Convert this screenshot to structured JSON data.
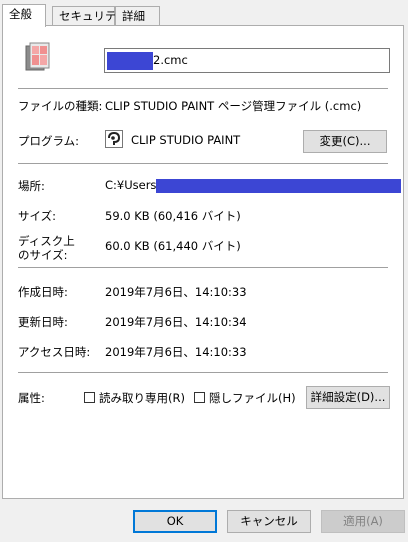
{
  "tabs": [
    "全般",
    "セキュリティ",
    "詳細"
  ],
  "file": {
    "name_suffix": "2.cmc"
  },
  "type": {
    "label": "ファイルの種類:",
    "value": "CLIP STUDIO PAINT ページ管理ファイル (.cmc)"
  },
  "program": {
    "label": "プログラム:",
    "value": "CLIP STUDIO PAINT",
    "change_button": "変更(C)..."
  },
  "location": {
    "label": "場所:",
    "value_prefix": "C:¥Users"
  },
  "size": {
    "label": "サイズ:",
    "value": "59.0 KB (60,416 バイト)"
  },
  "disk_size": {
    "label_line1": "ディスク上",
    "label_line2": "のサイズ:",
    "value": "60.0 KB (61,440 バイト)"
  },
  "created": {
    "label": "作成日時:",
    "value": "2019年7月6日、14:10:33"
  },
  "modified": {
    "label": "更新日時:",
    "value": "2019年7月6日、14:10:34"
  },
  "accessed": {
    "label": "アクセス日時:",
    "value": "2019年7月6日、14:10:33"
  },
  "attributes": {
    "label": "属性:",
    "readonly_label": "読み取り専用(R)",
    "hidden_label": "隠しファイル(H)",
    "advanced_button": "詳細設定(D)..."
  },
  "footer": {
    "ok": "OK",
    "cancel": "キャンセル",
    "apply": "適用(A)"
  },
  "colors": {
    "redaction": "#3c46d4",
    "focus_border": "#0078d7"
  }
}
